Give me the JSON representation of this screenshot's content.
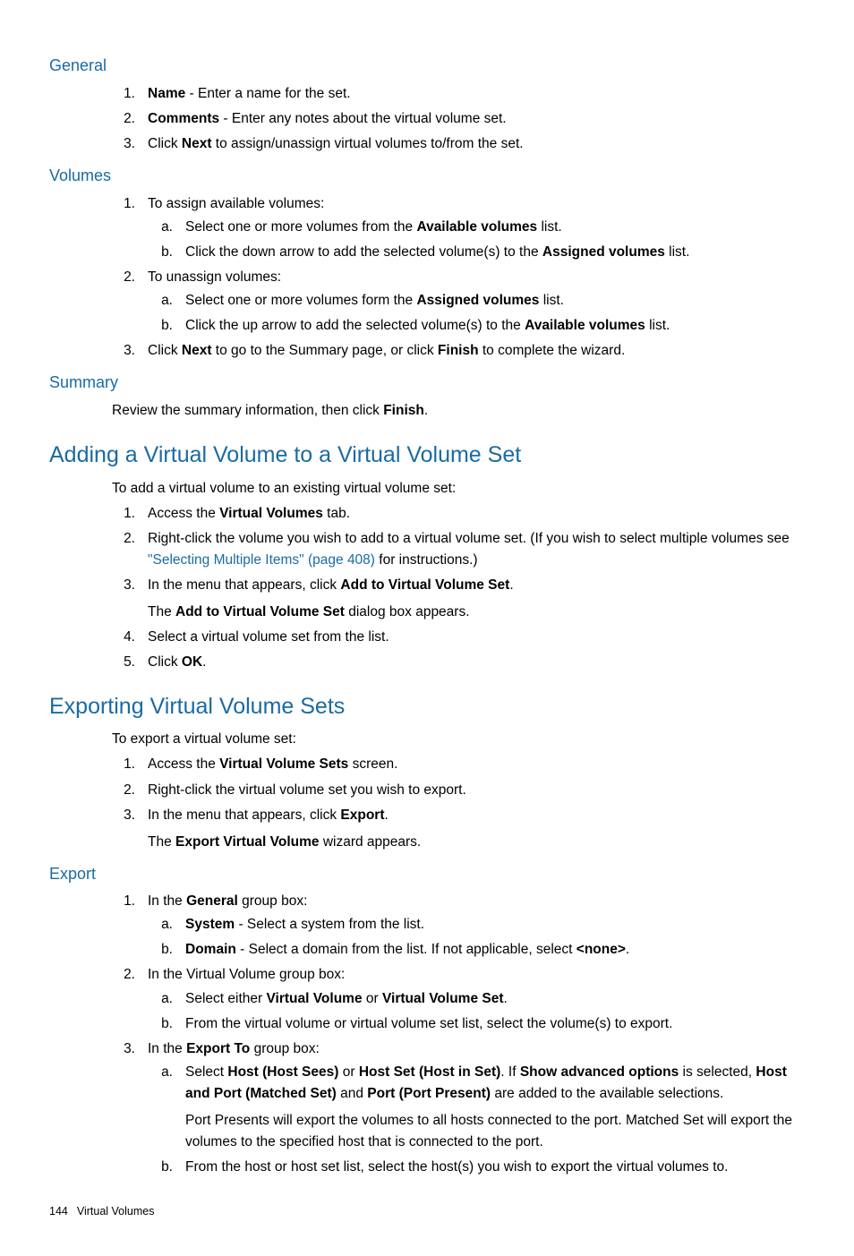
{
  "general": {
    "heading": "General",
    "items": [
      {
        "num": "1.",
        "pre": "Name",
        "post": " - Enter a name for the set."
      },
      {
        "num": "2.",
        "pre": "Comments",
        "post": " - Enter any notes about the virtual volume set."
      },
      {
        "num": "3.",
        "plain_before": "Click ",
        "bold1": "Next",
        "plain_after": " to assign/unassign virtual volumes to/from the set."
      }
    ]
  },
  "volumes": {
    "heading": "Volumes",
    "item1": {
      "num": "1.",
      "text": "To assign available volumes:",
      "sub": [
        {
          "m": "a.",
          "before": "Select one or more volumes from the ",
          "bold": "Available volumes",
          "after": " list."
        },
        {
          "m": "b.",
          "before": "Click the down arrow to add the selected volume(s) to the ",
          "bold": "Assigned volumes",
          "after": " list."
        }
      ]
    },
    "item2": {
      "num": "2.",
      "text": "To unassign volumes:",
      "sub": [
        {
          "m": "a.",
          "before": "Select one or more volumes form the ",
          "bold": "Assigned volumes",
          "after": " list."
        },
        {
          "m": "b.",
          "before": "Click the up arrow to add the selected volume(s) to the ",
          "bold": "Available volumes",
          "after": " list."
        }
      ]
    },
    "item3": {
      "num": "3.",
      "t1": "Click ",
      "b1": "Next",
      "t2": " to go to the Summary page, or click ",
      "b2": "Finish",
      "t3": " to complete the wizard."
    }
  },
  "summary": {
    "heading": "Summary",
    "t1": "Review the summary information, then click ",
    "b1": "Finish",
    "t2": "."
  },
  "adding": {
    "heading": "Adding a Virtual Volume to a Virtual Volume Set",
    "intro": "To add a virtual volume to an existing virtual volume set:",
    "items": {
      "i1": {
        "num": "1.",
        "t1": "Access the ",
        "b1": "Virtual Volumes",
        "t2": " tab."
      },
      "i2": {
        "num": "2.",
        "t1": "Right-click the volume you wish to add to a virtual volume set. (If you wish to select multiple volumes see ",
        "link": "\"Selecting Multiple Items\" (page 408)",
        "t2": " for instructions.)"
      },
      "i3": {
        "num": "3.",
        "t1": "In the menu that appears, click ",
        "b1": "Add to Virtual Volume Set",
        "t2": ".",
        "extra_t1": "The ",
        "extra_b1": "Add to Virtual Volume Set",
        "extra_t2": " dialog box appears."
      },
      "i4": {
        "num": "4.",
        "text": "Select a virtual volume set from the list."
      },
      "i5": {
        "num": "5.",
        "t1": "Click ",
        "b1": "OK",
        "t2": "."
      }
    }
  },
  "exporting": {
    "heading": "Exporting Virtual Volume Sets",
    "intro": "To export a virtual volume set:",
    "items": {
      "i1": {
        "num": "1.",
        "t1": "Access the ",
        "b1": "Virtual Volume Sets",
        "t2": " screen."
      },
      "i2": {
        "num": "2.",
        "text": "Right-click the virtual volume set you wish to export."
      },
      "i3": {
        "num": "3.",
        "t1": "In the menu that appears, click ",
        "b1": "Export",
        "t2": ".",
        "extra_t1": "The ",
        "extra_b1": "Export Virtual Volume",
        "extra_t2": " wizard appears."
      }
    }
  },
  "export": {
    "heading": "Export",
    "item1": {
      "num": "1.",
      "t1": "In the ",
      "b1": "General",
      "t2": " group box:",
      "sub": {
        "a": {
          "m": "a.",
          "b1": "System",
          "t1": " - Select a system from the list."
        },
        "b": {
          "m": "b.",
          "b1": "Domain",
          "t1": " - Select a domain from the list. If not applicable, select ",
          "b2": "<none>",
          "t2": "."
        }
      }
    },
    "item2": {
      "num": "2.",
      "text": "In the Virtual Volume group box:",
      "sub": {
        "a": {
          "m": "a.",
          "t1": "Select either ",
          "b1": "Virtual Volume",
          "t2": " or ",
          "b2": "Virtual Volume Set",
          "t3": "."
        },
        "b": {
          "m": "b.",
          "text": "From the virtual volume or virtual volume set list, select the volume(s) to export."
        }
      }
    },
    "item3": {
      "num": "3.",
      "t1": "In the ",
      "b1": "Export To",
      "t2": " group box:",
      "sub": {
        "a": {
          "m": "a.",
          "t1": "Select ",
          "b1": "Host (Host Sees)",
          "t2": " or ",
          "b2": "Host Set (Host in Set)",
          "t3": ". If ",
          "b3": "Show advanced options",
          "t4": " is selected, ",
          "b4": "Host and Port (Matched Set)",
          "t5": " and ",
          "b5": "Port (Port Present)",
          "t6": " are added to the available selections.",
          "extra": "Port Presents will export the volumes to all hosts connected to the port. Matched Set will export the volumes to the specified host that is connected to the port."
        },
        "b": {
          "m": "b.",
          "text": "From the host or host set list, select the host(s) you wish to export the virtual volumes to."
        }
      }
    }
  },
  "footer": {
    "pagenum": "144",
    "section": "Virtual Volumes"
  }
}
